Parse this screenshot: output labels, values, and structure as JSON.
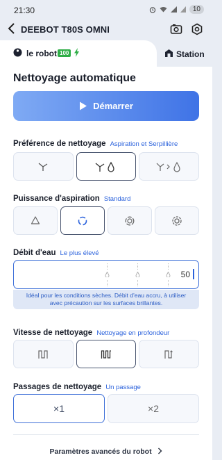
{
  "status_bar": {
    "time": "21:30",
    "battery": "10"
  },
  "header": {
    "title": "DEEBOT T80S OMNI"
  },
  "tabs": {
    "robot": "le robot",
    "robot_battery": "100",
    "station": "Station"
  },
  "main": {
    "title": "Nettoyage automatique",
    "start_label": "Démarrer",
    "cleaning_pref": {
      "label": "Préférence de nettoyage",
      "value": "Aspiration et Serpillière",
      "options": [
        "vacuum-icon",
        "vacuum-mop-icon",
        "vacuum-then-mop-icon"
      ],
      "selected_index": 1
    },
    "suction": {
      "label": "Puissance d'aspiration",
      "value": "Standard",
      "options": [
        "quiet-icon",
        "standard-icon",
        "max-icon",
        "max-plus-icon"
      ],
      "selected_index": 1
    },
    "water": {
      "label": "Débit d'eau",
      "value": "Le plus élevé",
      "level": "50",
      "note_line1": "Idéal pour les conditions sèches. Débit d'eau accru, à utiliser",
      "note_line2": "avec précaution sur les surfaces brillantes."
    },
    "speed": {
      "label": "Vitesse de nettoyage",
      "value": "Nettoyage en profondeur",
      "options": [
        "quick-path-icon",
        "deep-path-icon",
        "custom-path-icon"
      ],
      "selected_index": 1
    },
    "passes": {
      "label": "Passages de nettoyage",
      "value": "Un passage",
      "options": [
        "×1",
        "×2"
      ],
      "selected_index": 0
    },
    "advanced_label": "Paramètres avancés du robot"
  }
}
